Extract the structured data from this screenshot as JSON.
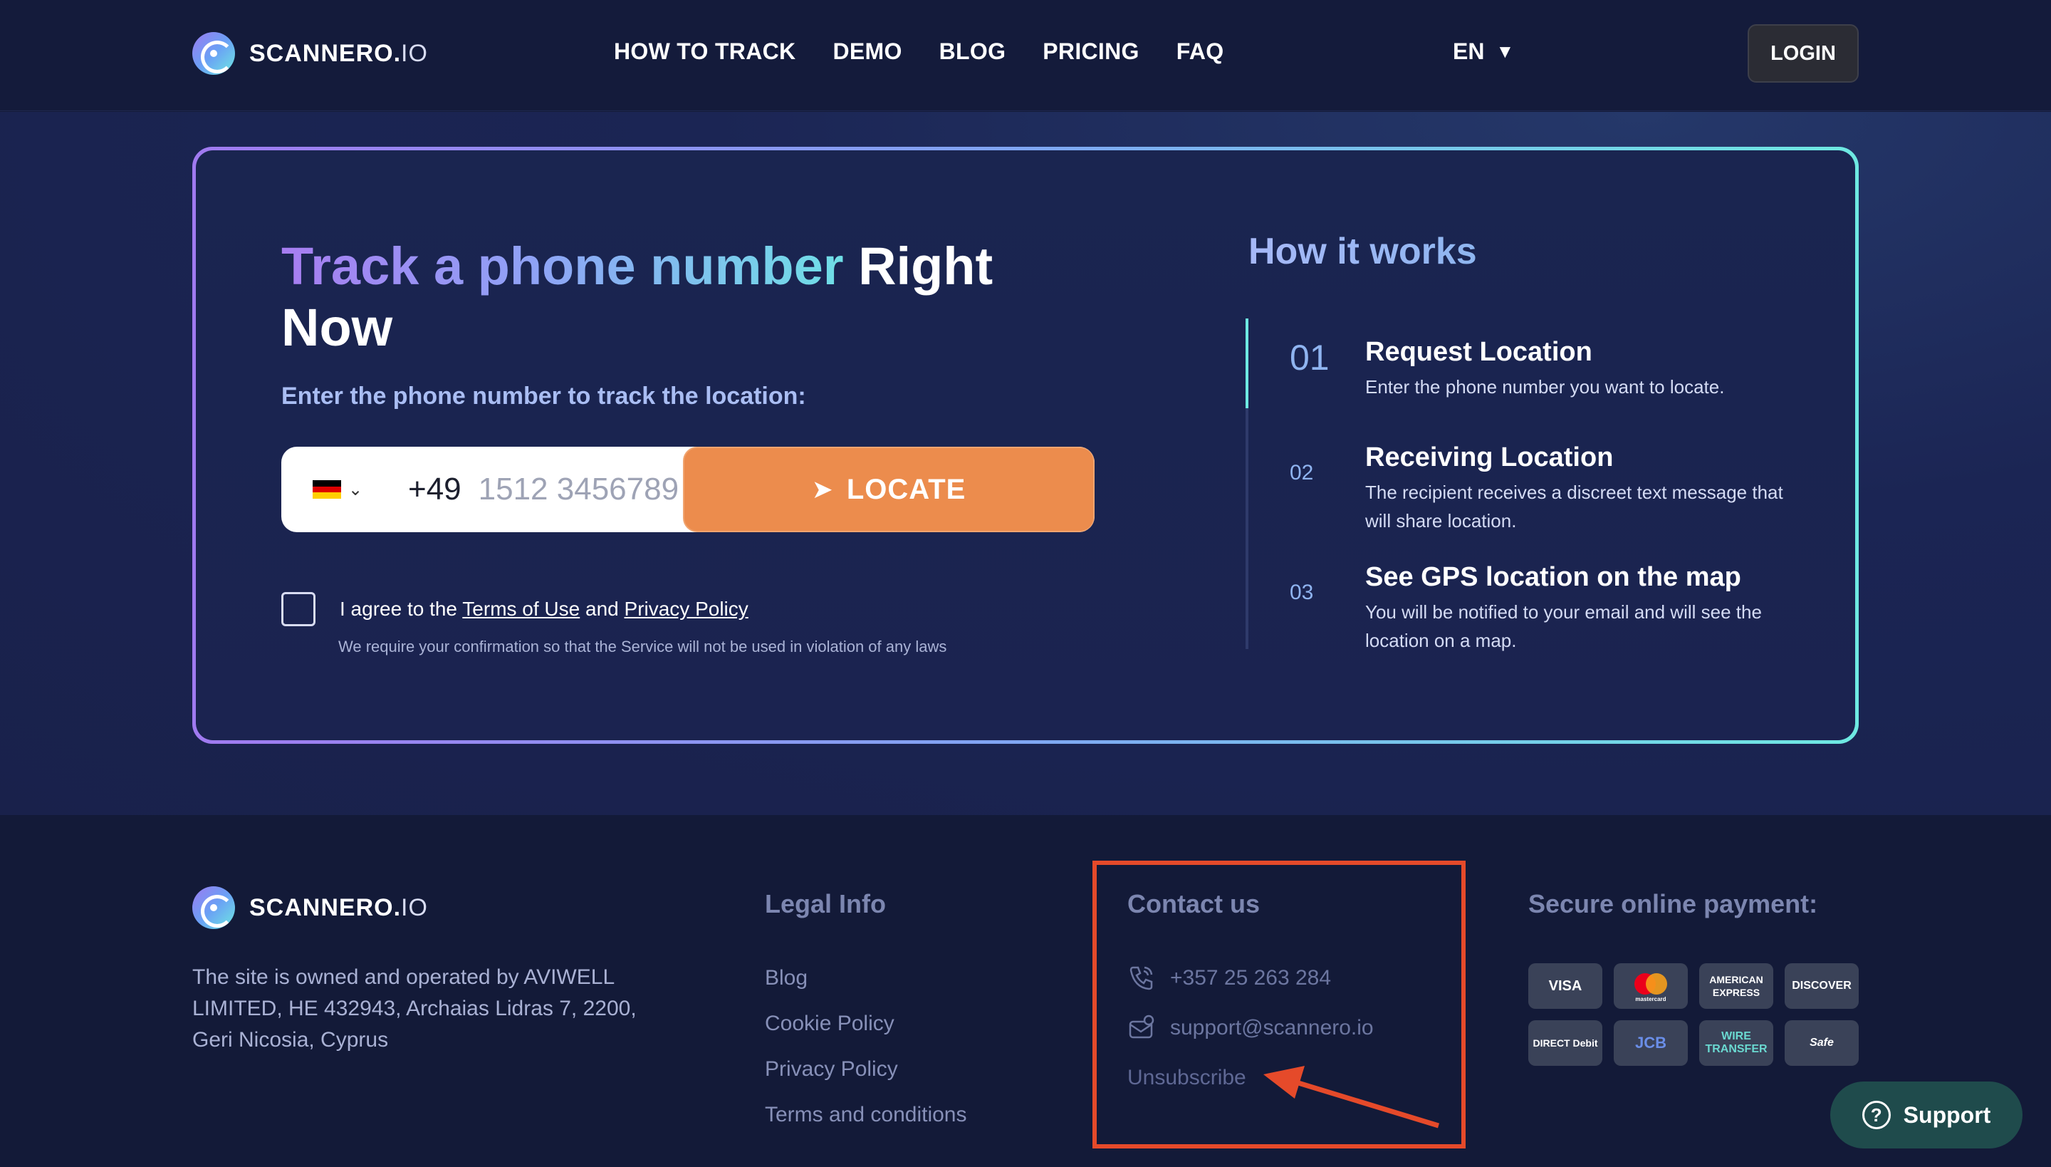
{
  "brand": {
    "name": "SCANNERO.",
    "suffix": "IO"
  },
  "nav": [
    {
      "label": "HOW TO TRACK"
    },
    {
      "label": "DEMO"
    },
    {
      "label": "BLOG"
    },
    {
      "label": "PRICING"
    },
    {
      "label": "FAQ"
    }
  ],
  "language": {
    "label": "EN",
    "caret": "▼"
  },
  "login": {
    "label": "LOGIN"
  },
  "hero": {
    "title_part1": "Track a phone number",
    "title_part2": "Right Now",
    "subtitle": "Enter the phone number to track the location:",
    "country_flag": "germany-flag",
    "dial_code": "+49",
    "phone_placeholder": "1512 3456789",
    "locate_label": "LOCATE",
    "agree_prefix": "I agree to the",
    "terms_link": "Terms of Use",
    "and_text": "and",
    "privacy_link": "Privacy Policy",
    "agree_note": "We require your confirmation so that the Service will not be used in violation of any laws"
  },
  "how_it_works": {
    "title": "How it works",
    "steps": [
      {
        "num": "01",
        "title": "Request Location",
        "desc": "Enter the phone number you want to locate."
      },
      {
        "num": "02",
        "title": "Receiving Location",
        "desc": "The recipient receives a discreet text message that will share location."
      },
      {
        "num": "03",
        "title": "See GPS location on the map",
        "desc": "You will be notified to your email and will see the location on a map."
      }
    ]
  },
  "footer": {
    "about": "The site is owned and operated by AVIWELL LIMITED, HE 432943, Archaias Lidras 7, 2200, Geri Nicosia, Cyprus",
    "legal_title": "Legal Info",
    "legal_links": [
      "Blog",
      "Cookie Policy",
      "Privacy Policy",
      "Terms and conditions"
    ],
    "contact_title": "Contact us",
    "phone": "+357 25 263 284",
    "email": "support@scannero.io",
    "unsubscribe": "Unsubscribe",
    "payment_title": "Secure online payment:",
    "payments": [
      {
        "label": "VISA",
        "color": "#3a4258"
      },
      {
        "label": "mastercard",
        "color": "#3a4258"
      },
      {
        "label": "AMERICAN EXPRESS",
        "color": "#3a4258"
      },
      {
        "label": "DISCOVER",
        "color": "#3a4258"
      },
      {
        "label": "DIRECT Debit",
        "color": "#3a4258"
      },
      {
        "label": "JCB",
        "color": "#3a4258"
      },
      {
        "label": "WIRE TRANSFER",
        "color": "#3a4258"
      },
      {
        "label": "Safe",
        "color": "#3a4258"
      }
    ]
  },
  "support": {
    "label": "Support"
  },
  "colors": {
    "accent_orange": "#ec8c4d",
    "annotation_red": "#e54a2a",
    "gradient_start": "#a07af0",
    "gradient_end": "#6ee9e2"
  }
}
